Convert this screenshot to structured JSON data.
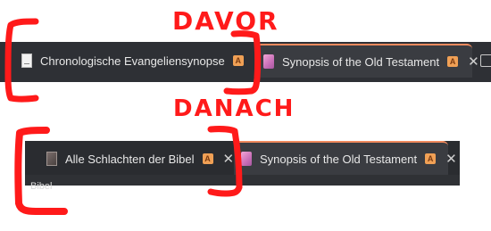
{
  "annotations": {
    "before_label": "DAVOR",
    "after_label": "DANACH",
    "marker_color": "#ff1a1a"
  },
  "before": {
    "tabs": [
      {
        "title": "Chronologische Evangeliensynopse",
        "favicon": "document-icon",
        "badge": "A",
        "close": "✕",
        "active": false
      },
      {
        "title": "Synopsis of the Old Testament",
        "favicon": "pink-book-icon",
        "badge": "A",
        "close": "✕",
        "active": true
      }
    ],
    "extra_icon": "calendar-icon"
  },
  "after": {
    "tabs": [
      {
        "title": "Alle Schlachten der Bibel",
        "favicon": "book-icon",
        "badge": "A",
        "close": "✕",
        "active": false
      },
      {
        "title": "Synopsis of the Old Testament",
        "favicon": "pink-book-icon",
        "badge": "A",
        "close": "✕",
        "active": true
      }
    ],
    "below_text": "Bibel"
  },
  "colors": {
    "tabstrip_bg": "#2e3035",
    "active_tab_bg": "#3a3c41",
    "active_tab_accent": "#f08a5d",
    "badge_bg": "#f0a055"
  }
}
